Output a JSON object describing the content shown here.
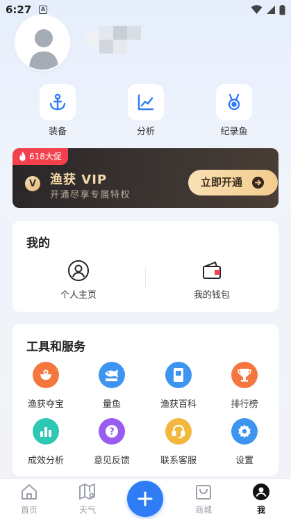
{
  "status_bar": {
    "time": "6:27",
    "notification_glyph": "A"
  },
  "profile": {
    "avatar": "default-avatar-icon",
    "username_pixelated": true
  },
  "quick_actions": [
    {
      "label": "装备",
      "icon": "anchor-icon"
    },
    {
      "label": "分析",
      "icon": "line-chart-icon"
    },
    {
      "label": "纪录鱼",
      "icon": "medal-icon"
    }
  ],
  "vip_banner": {
    "tag": "618大促",
    "badge": "V",
    "title": "渔获 VIP",
    "subtitle": "开通尽享专属特权",
    "button": "立即开通",
    "colors": {
      "background": "#2a2628",
      "gold": "#f4d9a8",
      "tag": "#f2414d"
    }
  },
  "mine": {
    "title": "我的",
    "items": [
      {
        "label": "个人主页",
        "icon": "person-circle-icon"
      },
      {
        "label": "我的钱包",
        "icon": "wallet-icon"
      }
    ]
  },
  "tools": {
    "title": "工具和服务",
    "items": [
      {
        "label": "渔获夺宝",
        "icon": "treasure-bowl-icon",
        "color": "#f4773f"
      },
      {
        "label": "量鱼",
        "icon": "fish-ruler-icon",
        "color": "#3d95f0"
      },
      {
        "label": "渔获百科",
        "icon": "encyclopedia-book-icon",
        "color": "#3d95f0"
      },
      {
        "label": "排行榜",
        "icon": "trophy-icon",
        "color": "#f4773f"
      },
      {
        "label": "成效分析",
        "icon": "bar-chart-icon",
        "color": "#2dc7b4"
      },
      {
        "label": "意见反馈",
        "icon": "question-icon",
        "color": "#9a5cf0"
      },
      {
        "label": "联系客服",
        "icon": "headset-icon",
        "color": "#f2b73c"
      },
      {
        "label": "设置",
        "icon": "gear-icon",
        "color": "#3d95f0"
      }
    ]
  },
  "tabbar": {
    "tabs": [
      {
        "label": "首页",
        "icon": "home-icon"
      },
      {
        "label": "天气",
        "icon": "weather-map-icon"
      },
      {
        "label": "商城",
        "icon": "shop-bag-icon"
      },
      {
        "label": "我",
        "icon": "profile-icon",
        "active": true
      }
    ],
    "fab_icon": "plus-icon",
    "accent": "#2f7cf6"
  }
}
